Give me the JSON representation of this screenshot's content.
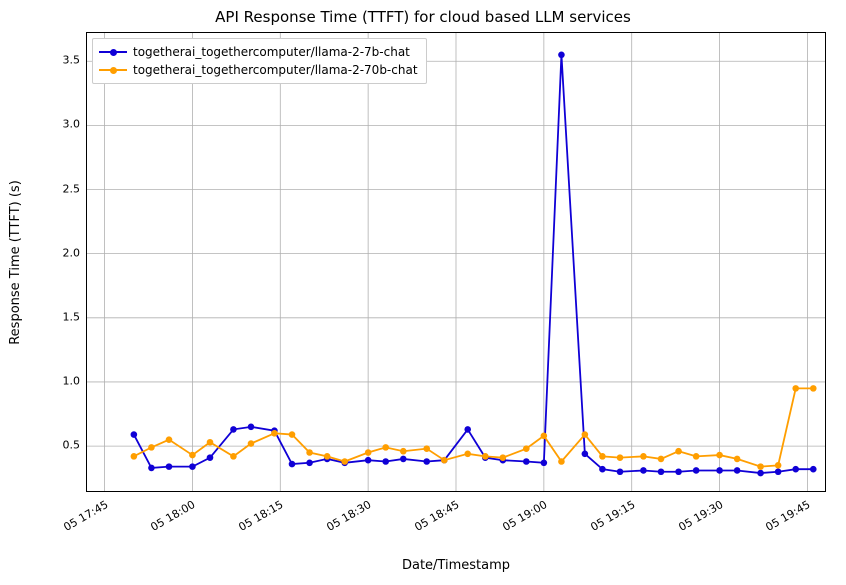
{
  "chart_data": {
    "type": "line",
    "title": "API Response Time (TTFT) for cloud based LLM services",
    "xlabel": "Date/Timestamp",
    "ylabel": "Response Time (TTFT) (s)",
    "ylim": [
      0.15,
      3.72
    ],
    "y_ticks": [
      0.5,
      1.0,
      1.5,
      2.0,
      2.5,
      3.0,
      3.5
    ],
    "x_tick_labels": [
      "05 17:45",
      "05 18:00",
      "05 18:15",
      "05 18:30",
      "05 18:45",
      "05 19:00",
      "05 19:15",
      "05 19:30",
      "05 19:45"
    ],
    "x_tick_positions_min": [
      0,
      15,
      30,
      45,
      60,
      75,
      90,
      105,
      120
    ],
    "x_range_min": [
      -3,
      123
    ],
    "x": [
      5,
      8,
      11,
      15,
      18,
      22,
      25,
      29,
      32,
      35,
      38,
      41,
      45,
      48,
      51,
      55,
      58,
      62,
      65,
      68,
      72,
      75,
      78,
      82,
      85,
      88,
      92,
      95,
      98,
      101,
      105,
      108,
      112,
      115,
      118,
      121
    ],
    "legend_position": "upper-left",
    "series": [
      {
        "name": "togetherai_togethercomputer/llama-2-7b-chat",
        "color": "#1000d6",
        "values": [
          0.59,
          0.33,
          0.34,
          0.34,
          0.41,
          0.63,
          0.65,
          0.62,
          0.36,
          0.37,
          0.4,
          0.37,
          0.39,
          0.38,
          0.4,
          0.38,
          0.39,
          0.63,
          0.41,
          0.39,
          0.38,
          0.37,
          3.55,
          0.44,
          0.32,
          0.3,
          0.31,
          0.3,
          0.3,
          0.31,
          0.31,
          0.31,
          0.29,
          0.3,
          0.32,
          0.32
        ]
      },
      {
        "name": "togetherai_togethercomputer/llama-2-70b-chat",
        "color": "#ff9e00",
        "values": [
          0.42,
          0.49,
          0.55,
          0.43,
          0.53,
          0.42,
          0.52,
          0.6,
          0.59,
          0.45,
          0.42,
          0.38,
          0.45,
          0.49,
          0.46,
          0.48,
          0.39,
          0.44,
          0.42,
          0.41,
          0.48,
          0.58,
          0.38,
          0.59,
          0.42,
          0.41,
          0.42,
          0.4,
          0.46,
          0.42,
          0.43,
          0.4,
          0.34,
          0.35,
          0.95,
          0.95
        ]
      }
    ]
  }
}
